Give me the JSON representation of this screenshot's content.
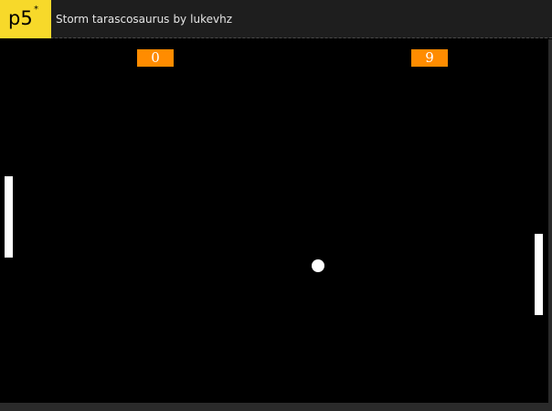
{
  "header": {
    "logo_text": "p5",
    "logo_mark": "*",
    "sketch_name": "Storm tarascosaurus",
    "by_label": "by",
    "author": "lukevhz"
  },
  "game": {
    "score_left": "0",
    "score_right": "9"
  },
  "colors": {
    "logo_bg": "#ed225d",
    "header_bg": "#1e1e1e",
    "canvas_bg": "#000000",
    "score_bg": "#ff8c00",
    "paddle": "#ffffff",
    "ball": "#ffffff"
  }
}
